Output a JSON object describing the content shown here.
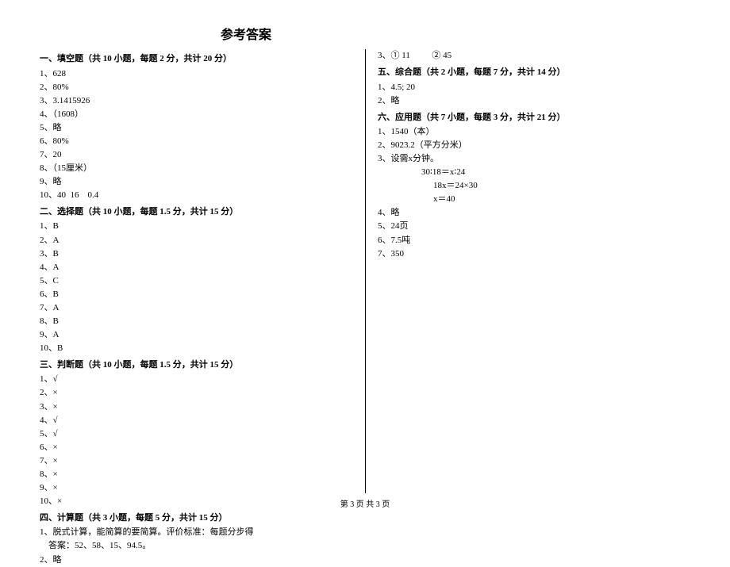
{
  "title": "参考答案",
  "footer": "第 3 页  共 3 页",
  "s1": {
    "header": "一、填空题（共 10 小题，每题 2 分，共计 20 分）",
    "i1": "1、628",
    "i2": "2、80%",
    "i3": "3、3.1415926",
    "i4": "4、（1608）",
    "i5": "5、略",
    "i6": "6、80%",
    "i7": "7、20",
    "i8": "8、（15厘米）",
    "i9": "9、略",
    "i10": "10、40  16    0.4"
  },
  "s2": {
    "header": "二、选择题（共 10 小题，每题 1.5 分，共计 15 分）",
    "i1": "1、B",
    "i2": "2、A",
    "i3": "3、B",
    "i4": "4、A",
    "i5": "5、C",
    "i6": "6、B",
    "i7": "7、A",
    "i8": "8、B",
    "i9": "9、A",
    "i10": "10、B"
  },
  "s3": {
    "header": "三、判断题（共 10 小题，每题 1.5 分，共计 15 分）",
    "i1": "1、√",
    "i2": "2、×",
    "i3": "3、×",
    "i4": "4、√",
    "i5": "5、√",
    "i6": "6、×",
    "i7": "7、×",
    "i8": "8、×",
    "i9": "9、×",
    "i10": "10、×"
  },
  "s4": {
    "header": "四、计算题（共 3 小题，每题 5 分，共计 15 分）",
    "i1a": "1、脱式计算，能简算的要简算。评价标准：每题分步得",
    "i1b": "    答案：52、58、15、94.5。",
    "i2": "2、略",
    "i3": "3、① 11          ② 45"
  },
  "s5": {
    "header": "五、综合题（共 2 小题，每题 7 分，共计 14 分）",
    "i1": "1、4.5; 20",
    "i2": "2、略"
  },
  "s6": {
    "header": "六、应用题（共 7 小题，每题 3 分，共计 21 分）",
    "i1": "1、1540（本）",
    "i2": "2、9023.2（平方分米）",
    "i3": "3、设需x分钟。",
    "i3a": "30∶18＝x∶24",
    "i3b": "18x＝24×30",
    "i3c": "x＝40",
    "i4": "4、略",
    "i5": "5、24页",
    "i6": "6、7.5吨",
    "i7": "7、350"
  }
}
